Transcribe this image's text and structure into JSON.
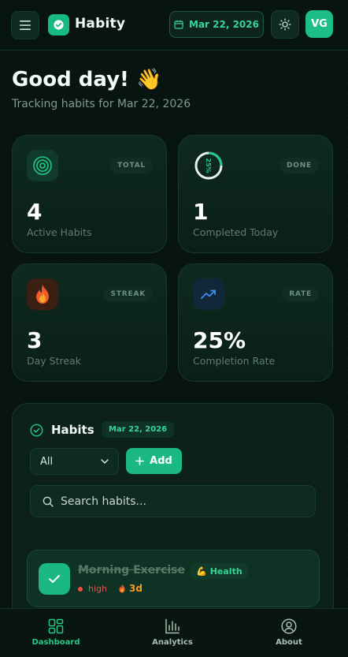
{
  "header": {
    "brand": "Habity",
    "date": "Mar 22, 2026",
    "avatar_initials": "VG"
  },
  "greeting": {
    "title": "Good day! 👋",
    "subtitle": "Tracking habits for Mar 22, 2026"
  },
  "stats": [
    {
      "badge": "TOTAL",
      "value": "4",
      "label": "Active Habits",
      "icon": "target-icon"
    },
    {
      "badge": "DONE",
      "value": "1",
      "label": "Completed Today",
      "icon": "progress-ring-icon",
      "ring_text": "25%",
      "ring_progress": 0.25
    },
    {
      "badge": "STREAK",
      "value": "3",
      "label": "Day Streak",
      "icon": "fire-icon"
    },
    {
      "badge": "RATE",
      "value": "25%",
      "label": "Completion Rate",
      "icon": "trending-up-icon"
    }
  ],
  "habits": {
    "title": "Habits",
    "date": "Mar 22, 2026",
    "filter_value": "All",
    "add_label": "Add",
    "search_placeholder": "Search habits...",
    "items": [
      {
        "name": "Morning Exercise",
        "category": "Health",
        "category_emoji": "💪",
        "priority": "high",
        "streak": "3d",
        "completed": true
      }
    ]
  },
  "nav": {
    "dashboard": "Dashboard",
    "analytics": "Analytics",
    "about": "About"
  },
  "colors": {
    "accent": "#1bb884",
    "background": "#07140f",
    "priority_high": "#ef4d4b",
    "streak": "#f59e1c"
  }
}
